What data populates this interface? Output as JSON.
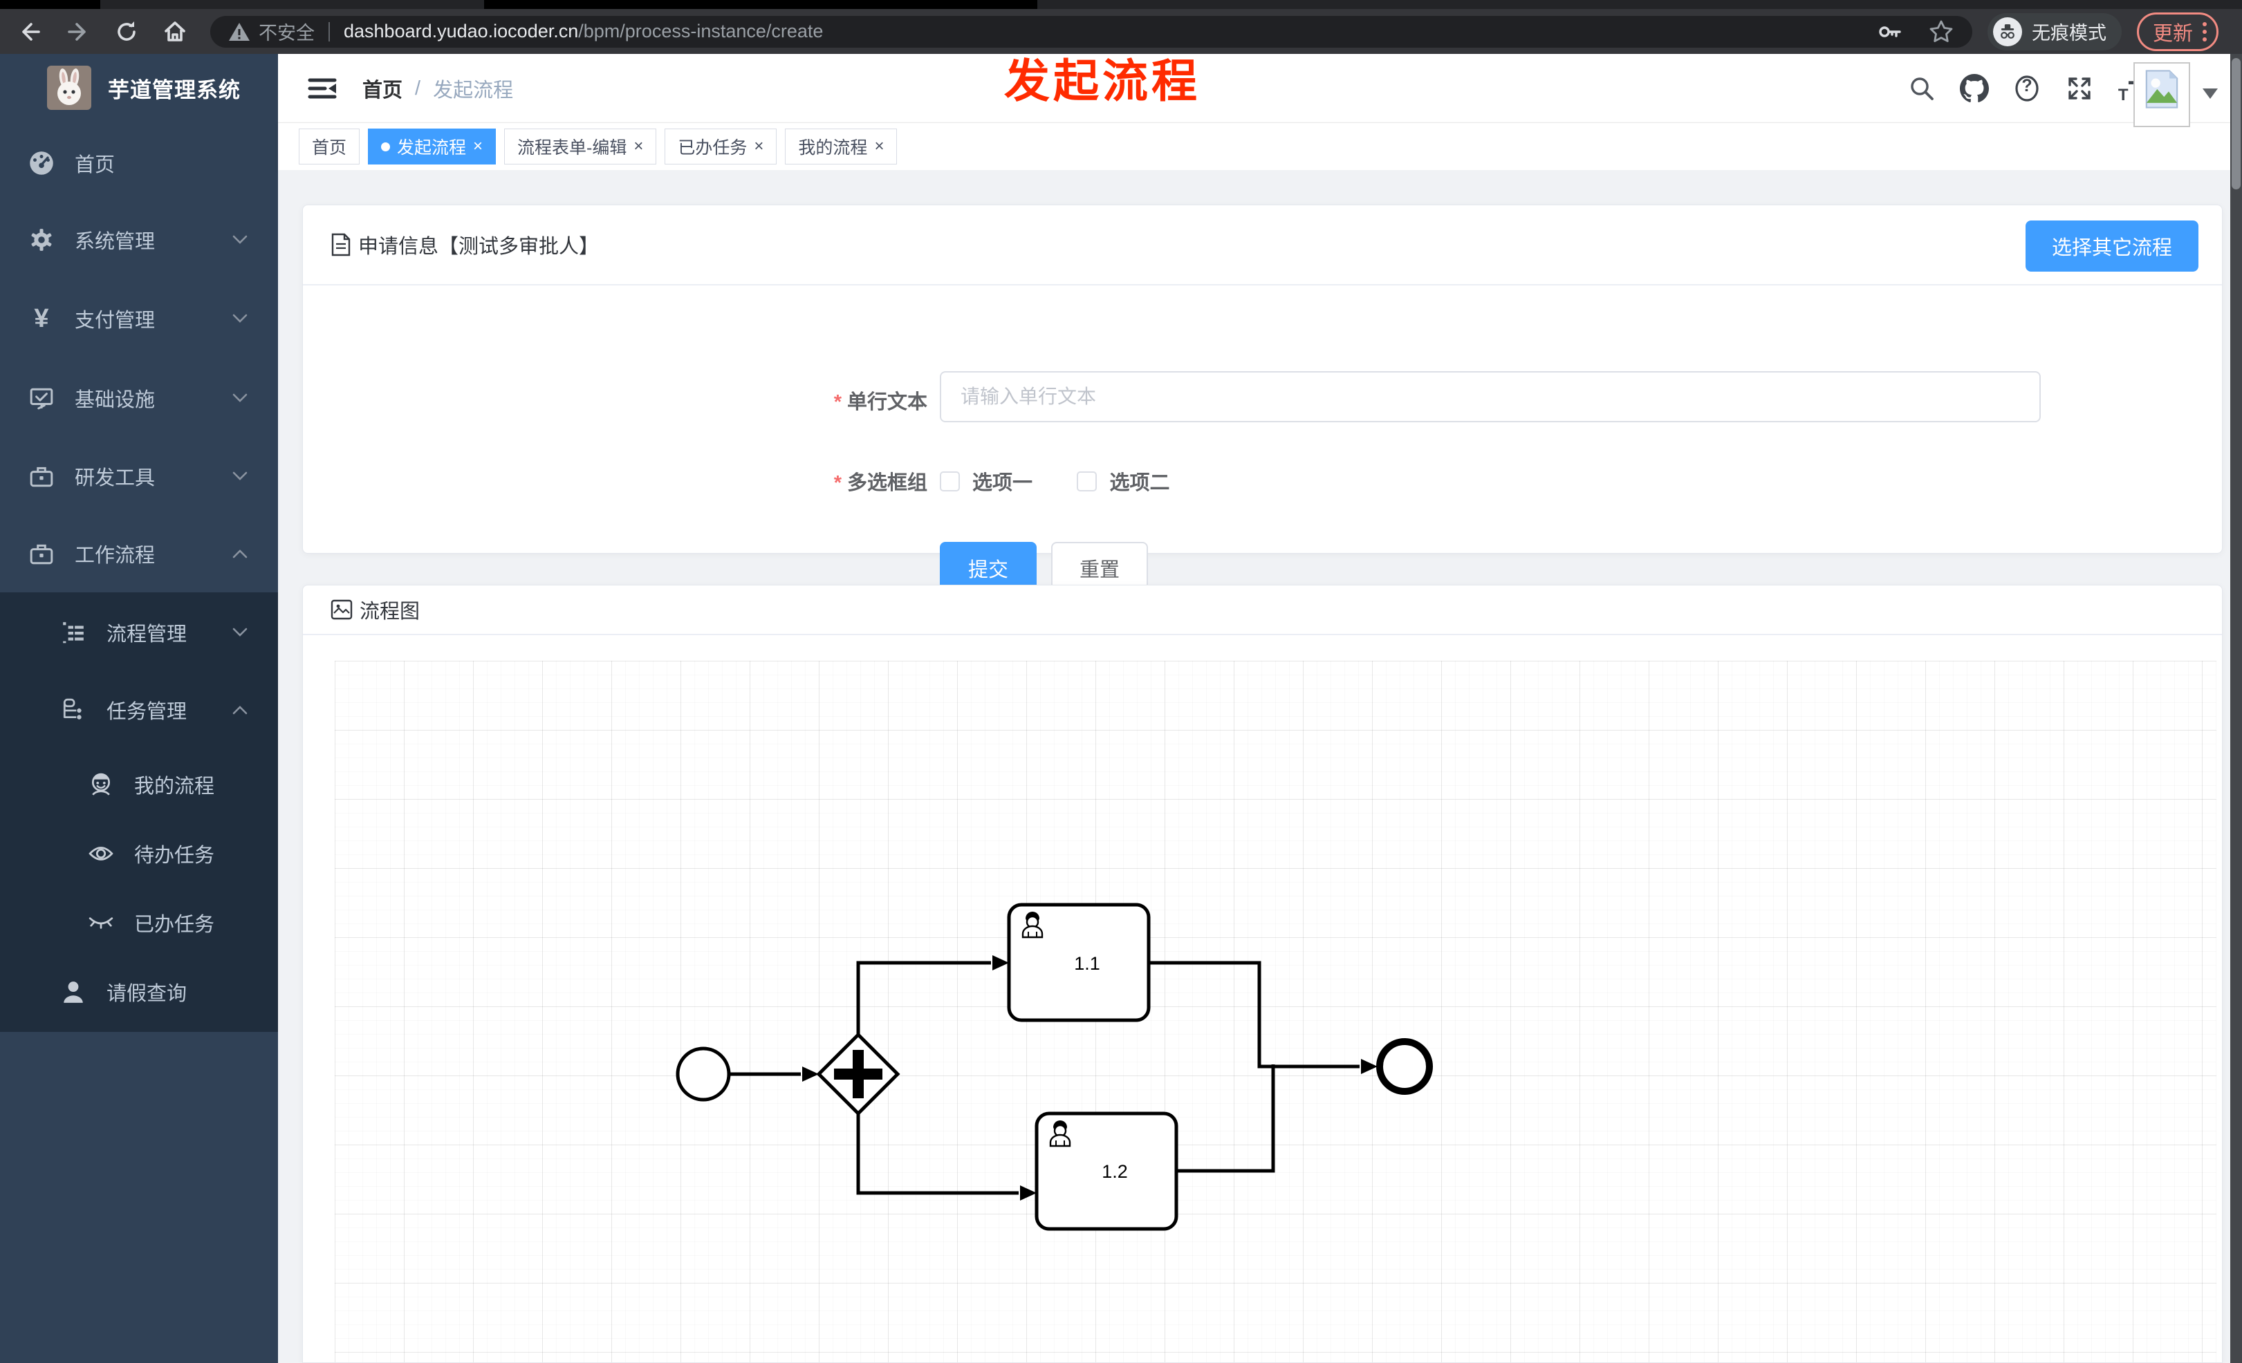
{
  "browser": {
    "security_label": "不安全",
    "url_domain": "dashboard.yudao.iocoder.cn",
    "url_path": "/bpm/process-instance/create",
    "incognito_label": "无痕模式",
    "update_label": "更新"
  },
  "annotation": {
    "text": "发起流程",
    "color": "#ff2b00"
  },
  "sidebar": {
    "logo_title": "芋道管理系统",
    "items": [
      {
        "label": "首页"
      },
      {
        "label": "系统管理"
      },
      {
        "label": "支付管理"
      },
      {
        "label": "基础设施"
      },
      {
        "label": "研发工具"
      },
      {
        "label": "工作流程"
      },
      {
        "label": "流程管理"
      },
      {
        "label": "任务管理"
      },
      {
        "label": "我的流程"
      },
      {
        "label": "待办任务"
      },
      {
        "label": "已办任务"
      },
      {
        "label": "请假查询"
      }
    ]
  },
  "header": {
    "breadcrumb_home": "首页",
    "breadcrumb_sep": "/",
    "breadcrumb_current": "发起流程"
  },
  "tabs": [
    {
      "label": "首页",
      "active": false,
      "closable": false
    },
    {
      "label": "发起流程",
      "active": true,
      "closable": true
    },
    {
      "label": "流程表单-编辑",
      "active": false,
      "closable": true
    },
    {
      "label": "已办任务",
      "active": false,
      "closable": true
    },
    {
      "label": "我的流程",
      "active": false,
      "closable": true
    }
  ],
  "apply_card": {
    "title": "申请信息【测试多审批人】",
    "choose_other_button": "选择其它流程",
    "fields": [
      {
        "label": "单行文本",
        "required": true,
        "placeholder": "请输入单行文本",
        "value": ""
      },
      {
        "label": "多选框组",
        "required": true,
        "options": [
          {
            "label": "选项一",
            "checked": false
          },
          {
            "label": "选项二",
            "checked": false
          }
        ]
      }
    ],
    "submit_label": "提交",
    "reset_label": "重置"
  },
  "diagram_card": {
    "title": "流程图",
    "type": "bpmn-preview",
    "nodes": [
      {
        "type": "start-event"
      },
      {
        "type": "parallel-gateway"
      },
      {
        "type": "user-task",
        "label": "1.1"
      },
      {
        "type": "user-task",
        "label": "1.2"
      },
      {
        "type": "end-event"
      }
    ]
  },
  "icons": {
    "close": "×",
    "kebab": "⋮",
    "slash": "/",
    "asterisk": "*",
    "yen": "¥",
    "question": "?",
    "t_small": "T",
    "t_large": "T"
  },
  "colors": {
    "accent": "#409eff",
    "sidebar_bg": "#304156",
    "submenu_bg": "#1f2d3d",
    "update_pill": "#f28b82",
    "required_red": "#f56c6c",
    "annotation_red": "#ff2b00"
  }
}
